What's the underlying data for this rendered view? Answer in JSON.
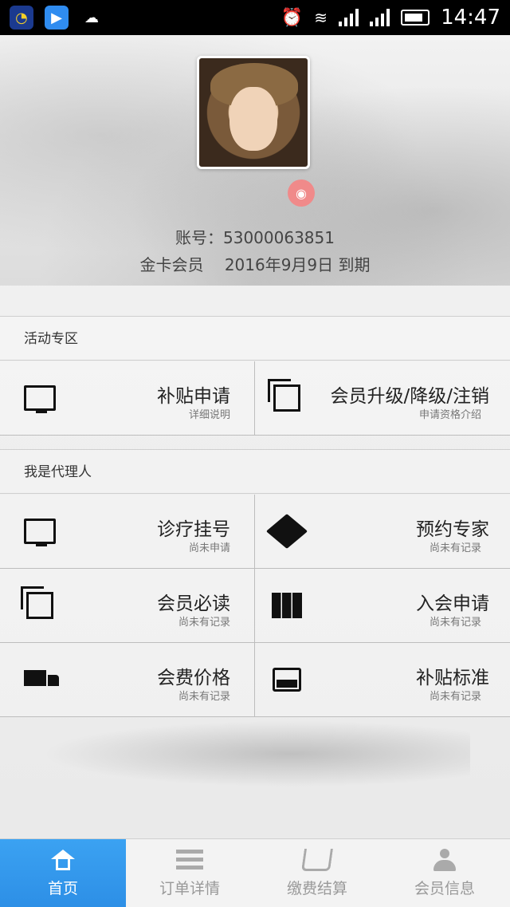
{
  "status_bar": {
    "time": "14:47",
    "icons": [
      "headset-icon",
      "video-player-icon",
      "weather-cloud-icon",
      "alarm-icon",
      "wifi-icon",
      "signal-icon",
      "signal-icon",
      "battery-icon"
    ]
  },
  "profile": {
    "account": "账号：53000063851",
    "member_level": "金卡会员",
    "expiry": "2016年9月9日 到期"
  },
  "sections": [
    {
      "title": "活动专区",
      "items": [
        {
          "title": "补贴申请",
          "sub": "详细说明",
          "icon": "monitor-icon"
        },
        {
          "title": "会员升级/降级/注销",
          "sub": "申请资格介绍",
          "icon": "copy-icon"
        }
      ]
    },
    {
      "title": "我是代理人",
      "items": [
        {
          "title": "诊疗挂号",
          "sub": "尚未申请",
          "icon": "monitor-icon"
        },
        {
          "title": "预约专家",
          "sub": "尚未有记录",
          "icon": "cube-icon"
        },
        {
          "title": "会员必读",
          "sub": "尚未有记录",
          "icon": "copy-icon"
        },
        {
          "title": "入会申请",
          "sub": "尚未有记录",
          "icon": "map-icon"
        },
        {
          "title": "会费价格",
          "sub": "尚未有记录",
          "icon": "truck-icon"
        },
        {
          "title": "补贴标准",
          "sub": "尚未有记录",
          "icon": "inbox-icon"
        }
      ]
    }
  ],
  "bottom_nav": [
    {
      "label": "首页",
      "icon": "home-icon",
      "active": true
    },
    {
      "label": "订单详情",
      "icon": "list-icon"
    },
    {
      "label": "缴费结算",
      "icon": "cart-icon"
    },
    {
      "label": "会员信息",
      "icon": "user-icon"
    }
  ],
  "colors": {
    "accent": "#2d8fe6",
    "camera_badge": "#f08a8a"
  }
}
